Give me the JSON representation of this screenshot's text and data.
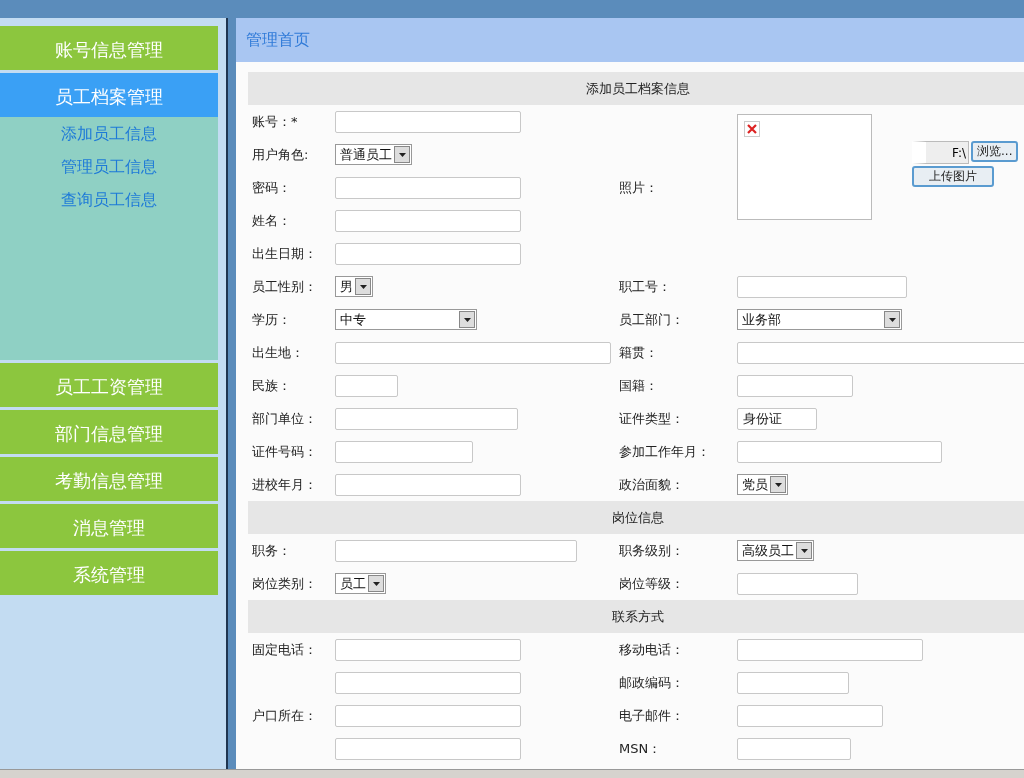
{
  "sidebar": {
    "items": [
      {
        "label": "账号信息管理",
        "selected": false
      },
      {
        "label": "员工档案管理",
        "selected": true,
        "children": [
          {
            "label": "添加员工信息"
          },
          {
            "label": "管理员工信息"
          },
          {
            "label": "查询员工信息"
          }
        ]
      },
      {
        "label": "员工工资管理",
        "selected": false
      },
      {
        "label": "部门信息管理",
        "selected": false
      },
      {
        "label": "考勤信息管理",
        "selected": false
      },
      {
        "label": "消息管理",
        "selected": false
      },
      {
        "label": "系统管理",
        "selected": false
      }
    ]
  },
  "panel_title": "管理首页",
  "photo": {
    "label": "照片：",
    "file_value": "F:\\",
    "browse": "浏览...",
    "upload": "上传图片"
  },
  "sections": [
    {
      "title": "添加员工档案信息",
      "rows": [
        {
          "left": {
            "label": "账号：*",
            "field": {
              "kind": "text"
            }
          }
        },
        {
          "left": {
            "label": "用户角色:",
            "field": {
              "kind": "select",
              "value": "普通员工"
            }
          }
        },
        {
          "left": {
            "label": "密码：",
            "field": {
              "kind": "text"
            }
          }
        },
        {
          "left": {
            "label": "姓名：",
            "field": {
              "kind": "text"
            }
          }
        },
        {
          "left": {
            "label": "出生日期：",
            "field": {
              "kind": "text"
            }
          }
        },
        {
          "left": {
            "label": "员工性别：",
            "field": {
              "kind": "select",
              "value": "男"
            }
          },
          "right": {
            "label": "职工号：",
            "field": {
              "kind": "text"
            }
          }
        },
        {
          "left": {
            "label": "学历：",
            "field": {
              "kind": "select",
              "value": "中专"
            }
          },
          "right": {
            "label": "员工部门：",
            "field": {
              "kind": "select",
              "value": "业务部"
            }
          }
        },
        {
          "left": {
            "label": "出生地：",
            "field": {
              "kind": "text"
            }
          },
          "right": {
            "label": "籍贯：",
            "field": {
              "kind": "text"
            }
          }
        },
        {
          "left": {
            "label": "民族：",
            "field": {
              "kind": "text"
            }
          },
          "right": {
            "label": "国籍：",
            "field": {
              "kind": "text"
            }
          }
        },
        {
          "left": {
            "label": "部门单位：",
            "field": {
              "kind": "text"
            }
          },
          "right": {
            "label": "证件类型：",
            "field": {
              "kind": "text",
              "value": "身份证"
            }
          }
        },
        {
          "left": {
            "label": "证件号码：",
            "field": {
              "kind": "text"
            }
          },
          "right": {
            "label": "参加工作年月：",
            "field": {
              "kind": "text"
            }
          }
        },
        {
          "left": {
            "label": "进校年月：",
            "field": {
              "kind": "text"
            }
          },
          "right": {
            "label": "政治面貌：",
            "field": {
              "kind": "select",
              "value": "党员"
            }
          }
        }
      ]
    },
    {
      "title": "岗位信息",
      "rows": [
        {
          "left": {
            "label": "职务：",
            "field": {
              "kind": "text"
            }
          },
          "right": {
            "label": "职务级别：",
            "field": {
              "kind": "select",
              "value": "高级员工"
            }
          }
        },
        {
          "left": {
            "label": "岗位类别：",
            "field": {
              "kind": "select",
              "value": "员工"
            }
          },
          "right": {
            "label": "岗位等级：",
            "field": {
              "kind": "text"
            }
          }
        }
      ]
    },
    {
      "title": "联系方式",
      "rows": [
        {
          "left": {
            "label": "固定电话：",
            "field": {
              "kind": "text"
            }
          },
          "right": {
            "label": "移动电话：",
            "field": {
              "kind": "text"
            }
          }
        },
        {
          "left": {
            "field": {
              "kind": "text"
            }
          },
          "right": {
            "label": "邮政编码：",
            "field": {
              "kind": "text"
            }
          }
        },
        {
          "left": {
            "label": "户口所在：",
            "field": {
              "kind": "text"
            }
          },
          "right": {
            "label": "电子邮件：",
            "field": {
              "kind": "text"
            }
          }
        },
        {
          "left": {
            "field": {
              "kind": "text"
            }
          },
          "right": {
            "label": "MSN：",
            "field": {
              "kind": "text"
            }
          }
        }
      ]
    }
  ]
}
